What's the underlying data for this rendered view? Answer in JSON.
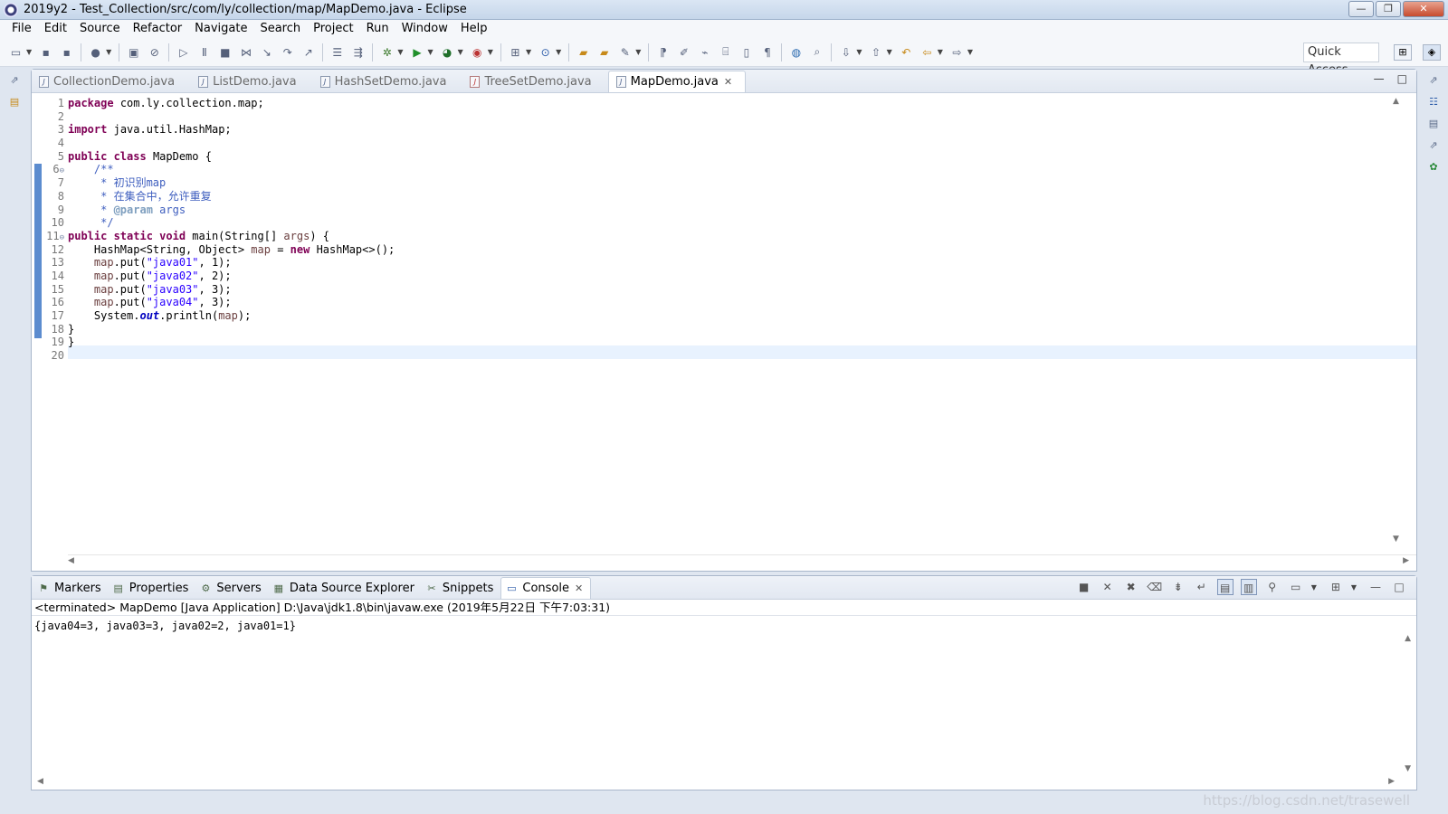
{
  "window": {
    "title": "2019y2 - Test_Collection/src/com/ly/collection/map/MapDemo.java - Eclipse",
    "min": "—",
    "max": "❐",
    "close": "✕"
  },
  "menu": [
    "File",
    "Edit",
    "Source",
    "Refactor",
    "Navigate",
    "Search",
    "Project",
    "Run",
    "Window",
    "Help"
  ],
  "toolbar": {
    "quick_access": "Quick Access"
  },
  "editor": {
    "tabs": [
      {
        "label": "CollectionDemo.java",
        "active": false
      },
      {
        "label": "ListDemo.java",
        "active": false
      },
      {
        "label": "HashSetDemo.java",
        "active": false
      },
      {
        "label": "TreeSetDemo.java",
        "active": false
      },
      {
        "label": "MapDemo.java",
        "active": true
      }
    ],
    "line_numbers": [
      "1",
      "2",
      "3",
      "4",
      "5",
      "6",
      "7",
      "8",
      "9",
      "10",
      "11",
      "12",
      "13",
      "14",
      "15",
      "16",
      "17",
      "18",
      "19",
      "20"
    ]
  },
  "console": {
    "tabs": [
      "Markers",
      "Properties",
      "Servers",
      "Data Source Explorer",
      "Snippets",
      "Console"
    ],
    "status": "<terminated> MapDemo [Java Application] D:\\Java\\jdk1.8\\bin\\javaw.exe (2019年5月22日 下午7:03:31)",
    "output": "{java04=3, java03=3, java02=2, java01=1}"
  },
  "watermark": "https://blog.csdn.net/trasewell"
}
